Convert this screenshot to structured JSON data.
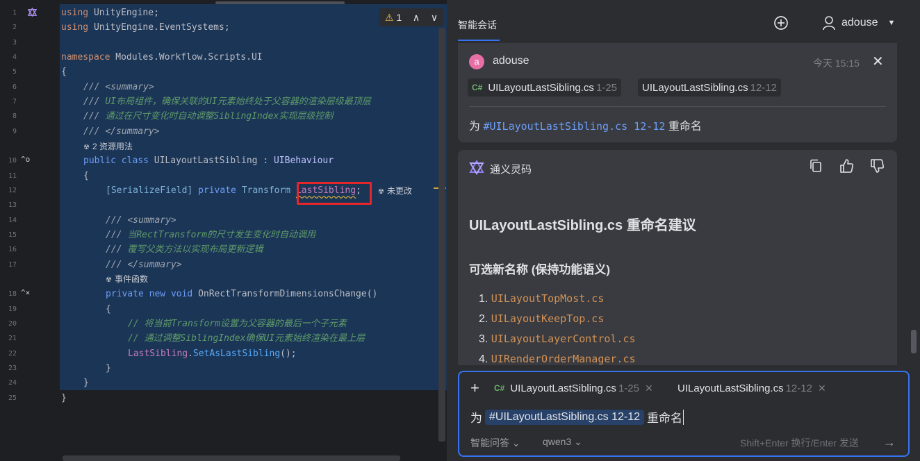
{
  "editor": {
    "line_numbers": [
      "1",
      "2",
      "3",
      "4",
      "5",
      "6",
      "7",
      "8",
      "9",
      "10",
      "11",
      "12",
      "13",
      "14",
      "15",
      "16",
      "17",
      "18",
      "19",
      "20",
      "21",
      "22",
      "23",
      "24",
      "25"
    ],
    "inspector": {
      "warning_count": "1",
      "up": "∧",
      "down": "∨"
    },
    "code": {
      "l1_kw": "using",
      "l1_ns": "UnityEngine",
      "semicolon": ";",
      "l2_kw": "using",
      "l2_ns": "UnityEngine.EventSystems",
      "l4_kw": "namespace",
      "l4_ns": "Modules.Workflow.Scripts.UI",
      "open_brace": "{",
      "close_brace": "}",
      "doc_prefix": "///",
      "summary_open": "<summary>",
      "summary_close": "</summary>",
      "l7_comment": "UI布局组件，确保关联的UI元素始终处于父容器的渲染层级最顶层",
      "l8_comment": "通过在尺寸变化时自动调整SiblingIndex实现层级控制",
      "usages_hint": "2 资源用法",
      "l10_public": "public",
      "l10_class": "class",
      "l10_name": "UILayoutLastSibling",
      "l10_colon": ":",
      "l10_base": "UIBehaviour",
      "l12_attr": "[SerializeField]",
      "l12_private": "private",
      "l12_type": "Transform",
      "l12_field": "LastSibling",
      "unchanged_hint": "未更改",
      "l15_comment": "当RectTransform的尺寸发生变化时自动调用",
      "l16_comment": "覆写父类方法以实现布局更新逻辑",
      "event_hint": "事件函数",
      "l18_private": "private",
      "l18_new": "new",
      "l18_void": "void",
      "l18_method": "OnRectTransformDimensionsChange()",
      "l20_comment": "// 将当前Transform设置为父容器的最后一个子元素",
      "l21_comment": "// 通过调整SiblingIndex确保UI元素始终渲染在最上层",
      "l22_field": "LastSibling",
      "l22_dot": ".",
      "l22_method": "SetAsLastSibling",
      "l22_call": "();"
    }
  },
  "chat": {
    "tab_label": "智能会话",
    "user_name": "adouse",
    "user_message": {
      "avatar_letter": "a",
      "author": "adouse",
      "time": "今天 15:15",
      "chips": [
        {
          "lang": "C#",
          "file": "UILayoutLastSibling.cs",
          "range": "1-25"
        },
        {
          "file": "UILayoutLastSibling.cs",
          "range": "12-12"
        }
      ],
      "text_prefix": "为",
      "text_ref": "#UILayoutLastSibling.cs 12-12",
      "text_suffix": "重命名"
    },
    "ai_message": {
      "name": "通义灵码",
      "heading": "UILayoutLastSibling.cs 重命名建议",
      "subheading": "可选新名称 (保持功能语义)",
      "options": [
        {
          "num": "1.",
          "name": "UILayoutTopMost.cs"
        },
        {
          "num": "2.",
          "name": "UILayoutKeepTop.cs"
        },
        {
          "num": "3.",
          "name": "UILayoutLayerControl.cs"
        },
        {
          "num": "4.",
          "name": "UIRenderOrderManager.cs"
        }
      ]
    },
    "input": {
      "chips": [
        {
          "lang": "C#",
          "file": "UILayoutLastSibling.cs",
          "range": "1-25"
        },
        {
          "file": "UILayoutLastSibling.cs",
          "range": "12-12"
        }
      ],
      "text_prefix": "为",
      "text_ref": "#UILayoutLastSibling.cs 12-12",
      "text_suffix": "重命名",
      "mode": "智能问答",
      "model": "qwen3",
      "send_hint": "Shift+Enter 换行/Enter 发送"
    }
  },
  "colors": {
    "accent": "#3574f0",
    "highlight_box": "#e5262b",
    "selection": "#1b3557"
  }
}
